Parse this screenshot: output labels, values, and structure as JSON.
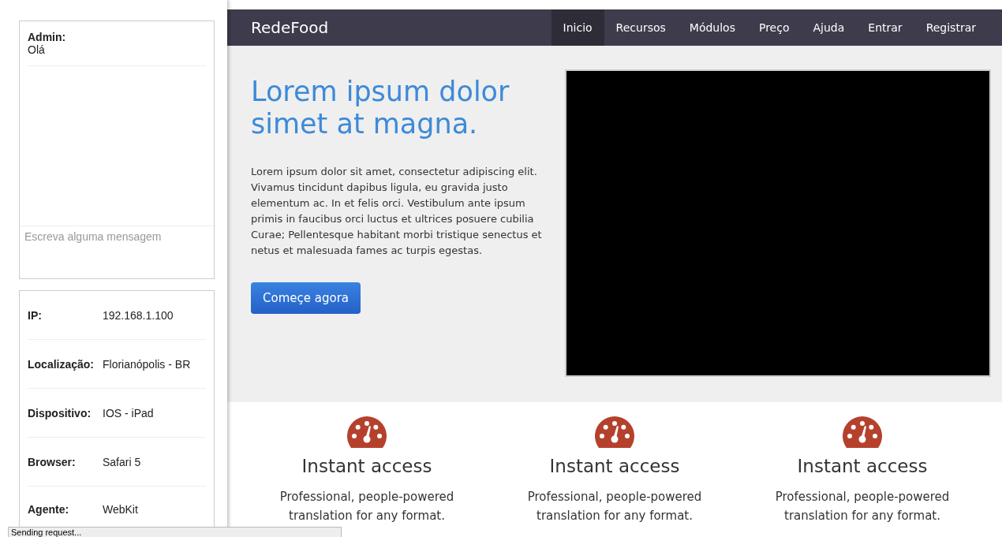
{
  "chat": {
    "sender": "Admin:",
    "message": "Olá",
    "input": {
      "placeholder": "Escreva alguma mensagem"
    }
  },
  "info": [
    {
      "label": "IP:",
      "value": "192.168.1.100"
    },
    {
      "label": "Localização:",
      "value": "Florianópolis - BR"
    },
    {
      "label": "Dispositivo:",
      "value": "IOS - iPad"
    },
    {
      "label": "Browser:",
      "value": "Safari 5"
    },
    {
      "label": "Agente:",
      "value": "WebKit"
    }
  ],
  "navbar": {
    "brand": "RedeFood",
    "items": [
      {
        "label": "Inicio",
        "selected": true
      },
      {
        "label": "Recursos",
        "selected": false
      },
      {
        "label": "Módulos",
        "selected": false
      },
      {
        "label": "Preço",
        "selected": false
      },
      {
        "label": "Ajuda",
        "selected": false
      },
      {
        "label": "Entrar",
        "selected": false
      },
      {
        "label": "Registrar",
        "selected": false
      }
    ]
  },
  "hero": {
    "title": "Lorem ipsum dolor simet at magna.",
    "text": "Lorem ipsum dolor sit amet, consectetur adipiscing elit. Vivamus tincidunt dapibus ligula, eu gravida justo elementum ac. In et felis orci. Vestibulum ante ipsum primis in faucibus orci luctus et ultrices posuere cubilia Curae; Pellentesque habitant morbi tristique senectus et netus et malesuada fames ac turpis egestas.",
    "button": "Começe agora"
  },
  "features": [
    {
      "title": "Instant access",
      "text": "Professional, people-powered translation for any format."
    },
    {
      "title": "Instant access",
      "text": "Professional, people-powered translation for any format."
    },
    {
      "title": "Instant access",
      "text": "Professional, people-powered translation for any format."
    }
  ],
  "status_bar": "Sending request..."
}
